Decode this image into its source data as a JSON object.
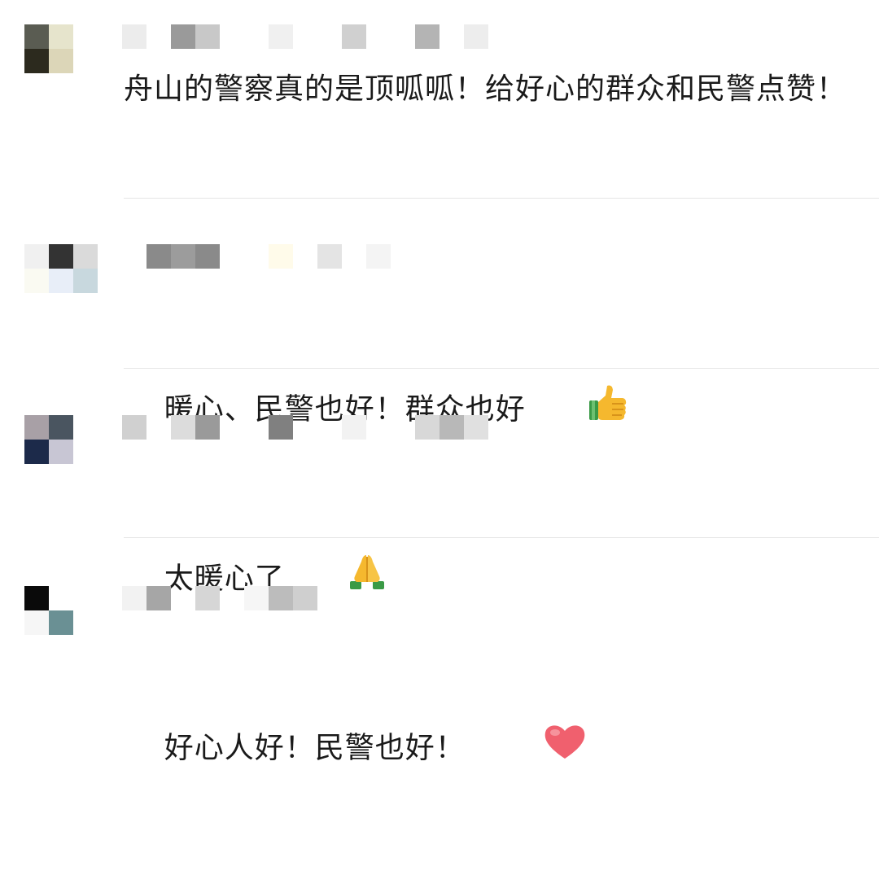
{
  "comments": [
    {
      "avatar_colors": [
        "#5a5c52",
        "#e6e4cc",
        "#ffffff",
        "#2c2a1e",
        "#dcd6b8",
        "#ffffff"
      ],
      "name_colors": [
        "#ececec",
        "#9a9a9a",
        "#c8c8c8",
        "#f0f0f0",
        "#d0d0d0",
        "#b4b4b4",
        "#ededed"
      ],
      "text": "舟山的警察真的是顶呱呱！给好心的群众和民警点赞！"
    },
    {
      "avatar_colors": [
        "#f0f0f0",
        "#333333",
        "#dadada",
        "#fafaf2",
        "#e8eef8",
        "#c8d8de"
      ],
      "name_colors": [
        "#8a8a8a",
        "#9c9c9c",
        "#8a8a8a",
        "#fffbea",
        "#e4e4e4",
        "#f4f4f4"
      ],
      "text": "暖心、民警也好！群众也好",
      "emoji": "thumbs-up-icon"
    },
    {
      "avatar_colors": [
        "#a8a0a6",
        "#4a5560",
        "#ffffff",
        "#1c2a4a",
        "#c8c6d4",
        "#ffffff"
      ],
      "name_colors": [
        "#d0d0d0",
        "#dcdcdc",
        "#9a9a9a",
        "#808080",
        "#f2f2f2",
        "#d8d8d8",
        "#b8b8b8",
        "#e0e0e0"
      ],
      "text": "太暖心了",
      "emoji": "folded-hands-icon"
    },
    {
      "avatar_colors": [
        "#0a0a0a",
        "#ffffff",
        "#ffffff",
        "#f6f6f6",
        "#6a9094",
        "#ffffff"
      ],
      "name_colors": [
        "#f2f2f2",
        "#a6a6a6",
        "#d6d6d6",
        "#f6f6f6",
        "#bcbcbc",
        "#cfcfcf"
      ],
      "text": "好心人好！民警也好！",
      "emoji": "heart-icon"
    }
  ],
  "colors": {
    "text": "#1a1a1a",
    "divider": "#e6e6e6",
    "heart": "#f0606e",
    "thumb": "#f5b82e",
    "sleeve": "#3a9a46"
  }
}
